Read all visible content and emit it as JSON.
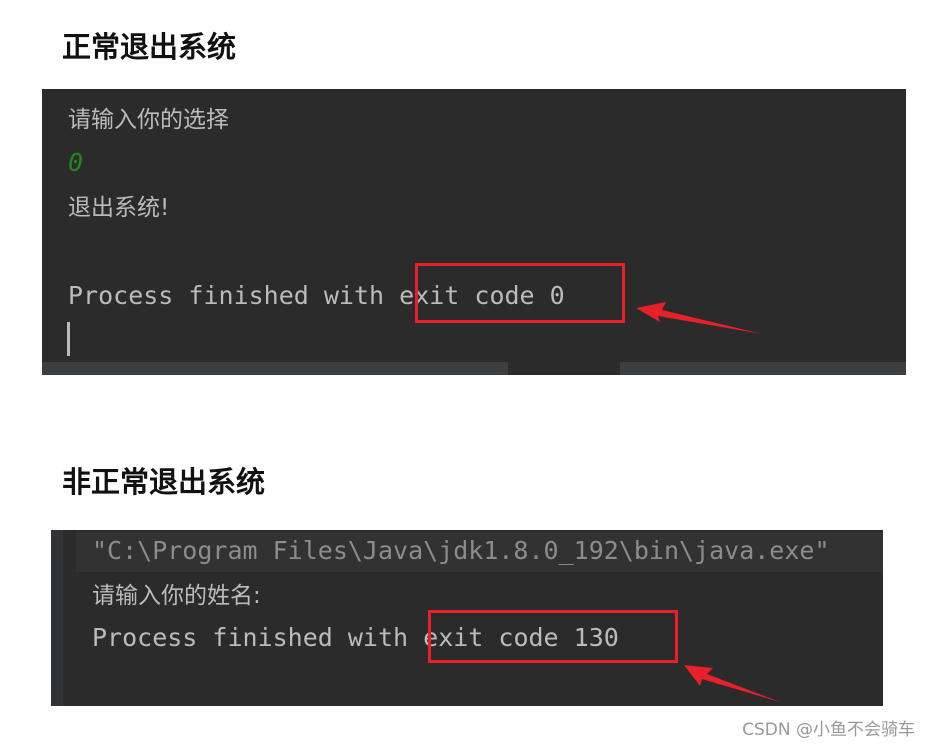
{
  "section1": {
    "title": "正常退出系统",
    "console": {
      "prompt": "请输入你的选择",
      "input": "0",
      "message": "退出系统!",
      "process_prefix": "Process finished with ",
      "process_highlight": "exit code 0"
    }
  },
  "section2": {
    "title": "非正常退出系统",
    "console": {
      "command": "\"C:\\Program Files\\Java\\jdk1.8.0_192\\bin\\java.exe\"",
      "prompt": "请输入你的姓名:",
      "process_prefix": "Process finished with ",
      "process_highlight": "exit code 130"
    }
  },
  "colors": {
    "console_bg": "#2b2b2b",
    "highlight_box": "#e8202a",
    "input_text": "#1d8a1d"
  },
  "watermark": "CSDN @小鱼不会骑车"
}
